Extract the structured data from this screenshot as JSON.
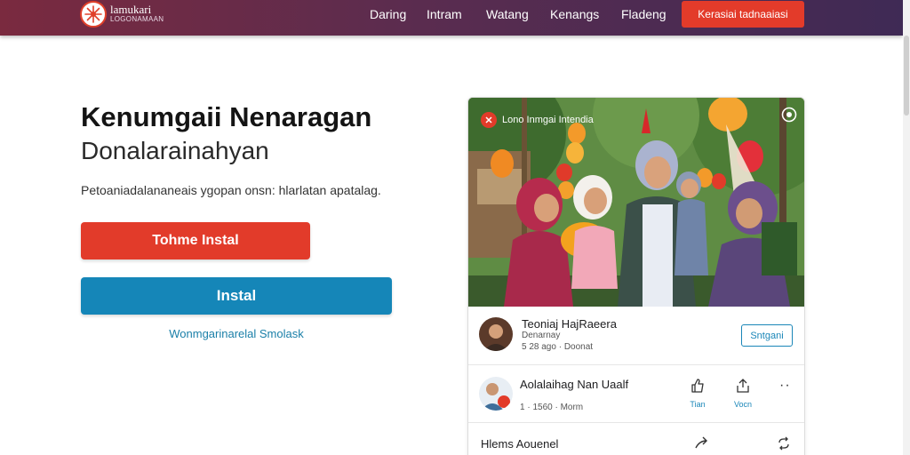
{
  "header": {
    "logo_title": "lamukari",
    "logo_sub": "LOGONAMAAN",
    "nav": [
      "Daring",
      "Intram",
      "Watang",
      "Kenangs",
      "Fladeng"
    ],
    "cta": "Kerasiai tadnaaiasi",
    "colors": {
      "bar_start": "#7a2a3f",
      "bar_end": "#3f2a55",
      "cta": "#e33b2a"
    }
  },
  "hero": {
    "title": "Kenumgaii Nenaragan",
    "subtitle": "Donalarainahyan",
    "description": "Petoaniadalananeais ygopan onsn: hlarlatan apatalag.",
    "primary_button": "Tohme Instal",
    "secondary_button": "Instal",
    "link": "Wonmgarinarelal Smolask",
    "colors": {
      "primary": "#e23b2a",
      "secondary": "#1586b8",
      "link": "#1a7fa8"
    }
  },
  "card": {
    "photo_caption": "Lono Inmgai Intendia",
    "author": {
      "name": "Teoniaj HajRaeera",
      "meta1": "Denarnay",
      "meta2": "5 28 ago · Doonat",
      "follow_label": "Sntgani"
    },
    "post": {
      "title": "Aolalaihag Nan Uaalf",
      "meta": "1 · 1560 · Morm",
      "like_label": "Tian",
      "share_label": "Vocn"
    },
    "bottom": {
      "title": "Hlems Aouenel"
    },
    "icons": [
      "play-icon",
      "thumb-icon",
      "share-icon",
      "more-icon",
      "forward-icon",
      "repost-icon"
    ]
  }
}
